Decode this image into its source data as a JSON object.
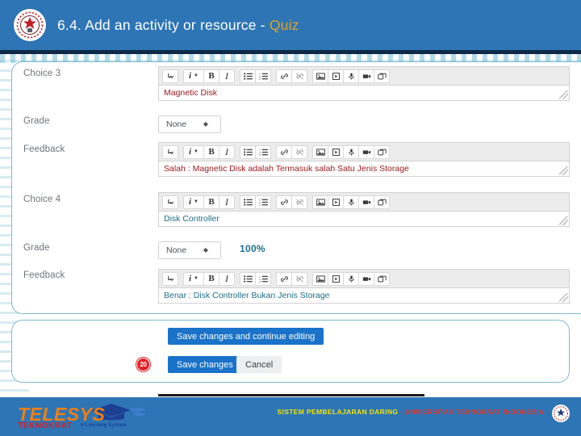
{
  "header": {
    "title_main": "6.4. Add an activity or resource - ",
    "title_accent": "Quiz",
    "logo_icon": "university-seal-icon",
    "bg_color": "#2e75b6",
    "accent_color": "#d8a32a"
  },
  "toolbar": {
    "buttons": [
      {
        "name": "expand-toolbar-icon",
        "glyph": "⤷"
      },
      {
        "name": "paragraph-style-icon",
        "glyph": "i"
      },
      {
        "name": "bold-icon",
        "glyph": "B"
      },
      {
        "name": "italic-icon",
        "glyph": "I"
      },
      {
        "name": "unordered-list-icon",
        "glyph": "≡"
      },
      {
        "name": "ordered-list-icon",
        "glyph": "≣"
      },
      {
        "name": "link-icon",
        "glyph": "ὑ7"
      },
      {
        "name": "unlink-icon",
        "glyph": "✂"
      },
      {
        "name": "image-icon",
        "glyph": "ὛC"
      },
      {
        "name": "media-file-icon",
        "glyph": "὜E"
      },
      {
        "name": "record-audio-icon",
        "glyph": "Ἱ9"
      },
      {
        "name": "record-video-icon",
        "glyph": "Ἲ5"
      },
      {
        "name": "manage-files-icon",
        "glyph": "὜2"
      }
    ]
  },
  "form": {
    "choice3": {
      "label": "Choice 3",
      "text": "Magnetic Disk",
      "text_color": "#9e1b20",
      "grade_label": "Grade",
      "grade_value": "None",
      "feedback_label": "Feedback",
      "feedback_text": "Salah : Magnetic Disk adalah Termasuk salah Satu Jenis Storage"
    },
    "choice4": {
      "label": "Choice 4",
      "text": "Disk Controller",
      "text_color": "#1f6e86",
      "grade_label": "Grade",
      "grade_value": "None",
      "grade_annotation": "100%",
      "feedback_label": "Feedback",
      "feedback_text": "Benar : Disk Controller Bukan Jenis Storage"
    }
  },
  "actions": {
    "save_continue": "Save changes and continue editing",
    "save": "Save changes",
    "cancel": "Cancel",
    "step_badge": "20"
  },
  "footer": {
    "brand_primary": "TELESYS",
    "brand_secondary": "TEKNOKRAT",
    "brand_sub": "e-Learning System",
    "tagline_yellow": "SISTEM PEMBELAJARAN DARING",
    "tagline_red": "- UNIVERSITAS TEKNOKRAT INDONESIA",
    "logo_icon": "university-seal-icon",
    "cap_icon": "graduation-cap-icon"
  }
}
